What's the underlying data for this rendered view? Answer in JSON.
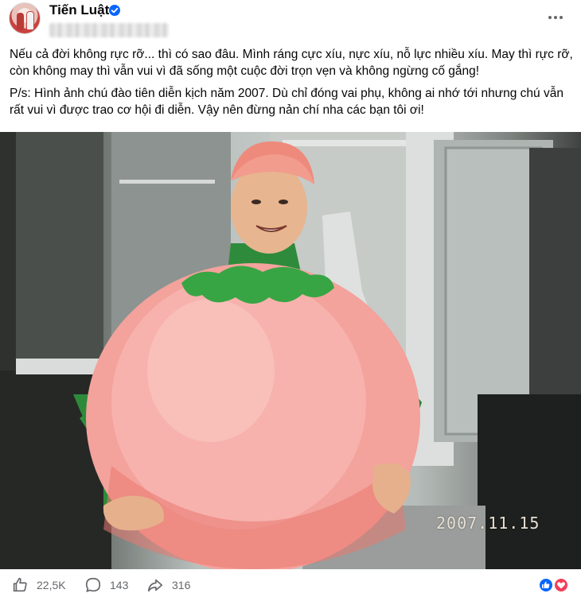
{
  "post": {
    "author": "Tiến Luật",
    "text_1": "Nếu cả đời không rực rỡ... thì có sao đâu. Mình ráng cực xíu, nực xíu, nỗ lực nhiều xíu. May thì rực rỡ, còn không may thì vẫn vui vì đã sống một cuộc đời trọn vẹn và không ngừng cố gắng!",
    "text_2": "P/s: Hình ảnh chú đào tiên diễn kịch năm 2007. Dù chỉ đóng vai phụ, không ai nhớ tới nhưng chú vẫn rất vui vì được trao cơ hội đi diễn. Vậy nên đừng nản chí nha các bạn tôi ơi!",
    "photo_date_stamp": "2007.11.15"
  },
  "footer": {
    "likes": "22,5K",
    "comments": "143",
    "shares": "316"
  },
  "icons": {
    "verified": "verified-badge-icon",
    "more": "more-options-icon",
    "like": "thumbs-up-icon",
    "comment": "comment-bubble-icon",
    "share": "share-arrow-icon",
    "reaction_like": "like-reaction-icon",
    "reaction_love": "love-reaction-icon"
  },
  "colors": {
    "verified": "#0866ff",
    "like_reaction": "#0866ff",
    "love_reaction": "#f33e58",
    "secondary_text": "#65676b"
  }
}
